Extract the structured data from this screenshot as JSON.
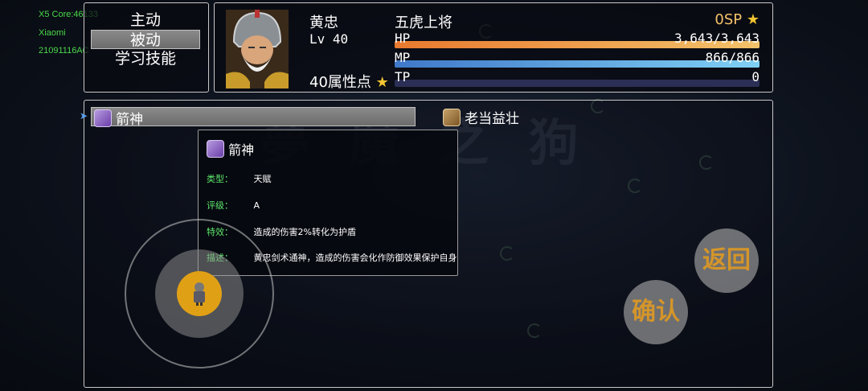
{
  "debug": {
    "core": "X5 Core:46133",
    "brand": "Xiaomi",
    "model": "21091116AC"
  },
  "menu": {
    "items": [
      {
        "label": "主动",
        "selected": false
      },
      {
        "label": "被动",
        "selected": true
      },
      {
        "label": "学习技能",
        "selected": false
      }
    ]
  },
  "character": {
    "name": "黄忠",
    "level": "Lv 40",
    "title": "五虎上将",
    "sp": "0SP",
    "attribute_points": "40属性点",
    "hp": {
      "label": "HP",
      "value": "3,643/3,643",
      "fraction": 1.0
    },
    "mp": {
      "label": "MP",
      "value": "866/866",
      "fraction": 1.0
    },
    "tp": {
      "label": "TP",
      "value": "0",
      "fraction": 0.0
    }
  },
  "skills": {
    "list": [
      {
        "name": "箭神",
        "icon": "bow-skill-icon"
      },
      {
        "name": "老当益壮",
        "icon": "bull-skill-icon"
      }
    ],
    "cursor": "➤"
  },
  "detail": {
    "name": "箭神",
    "rows": [
      {
        "key": "类型：",
        "value": "天赋"
      },
      {
        "key": "评级：",
        "value": "A"
      },
      {
        "key": "特效：",
        "value": "造成的伤害2%转化为护盾"
      },
      {
        "key": "描述：",
        "value": "黄忠剑术通神，造成的伤害会化作防御效果保护自身"
      }
    ]
  },
  "buttons": {
    "back": "返回",
    "confirm": "确认"
  },
  "colors": {
    "hp_gradient": [
      "#e9792f",
      "#f3c26a"
    ],
    "mp_gradient": [
      "#3f78c8",
      "#7fd0f5"
    ],
    "tp_track": "#2b2f55",
    "key_green": "#5ee86e",
    "button_text": "#d4952a"
  }
}
